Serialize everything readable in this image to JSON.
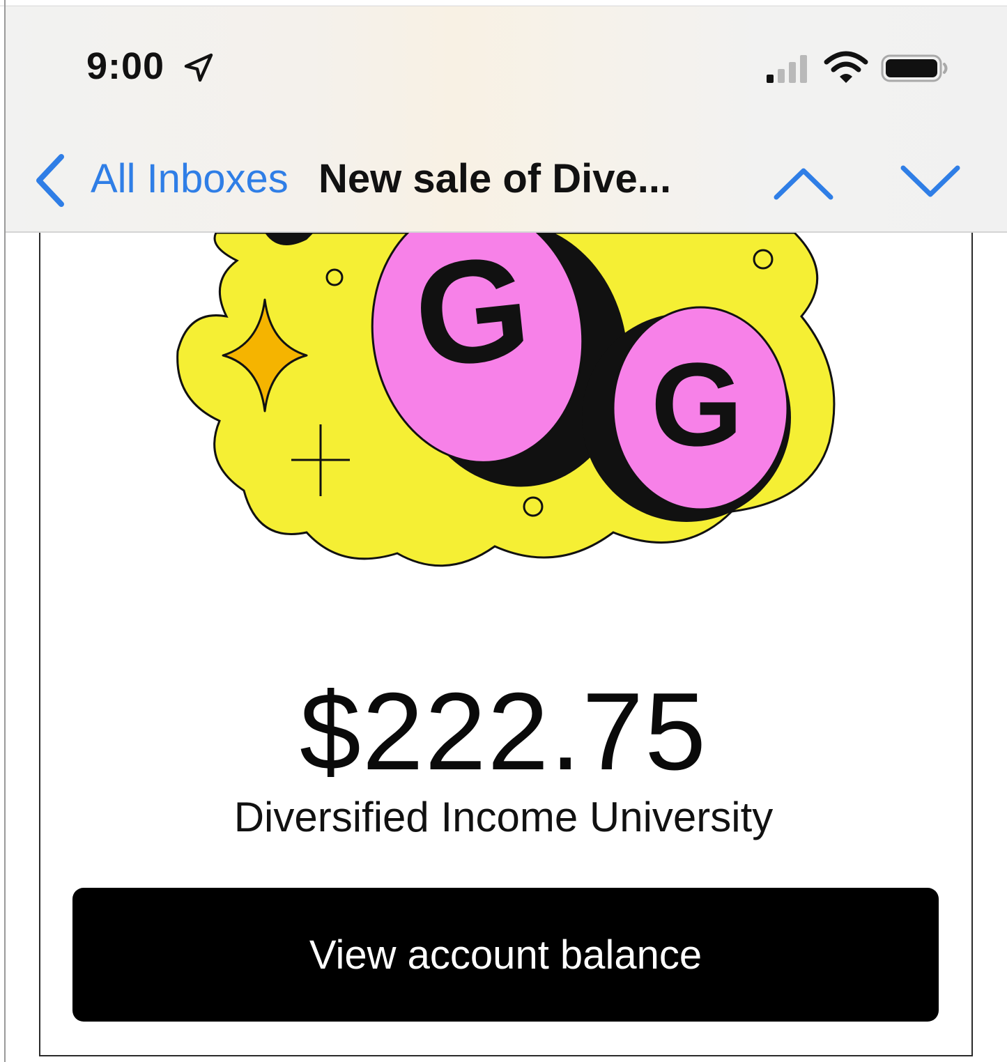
{
  "status_bar": {
    "time": "9:00",
    "icons": [
      "location-arrow-icon",
      "cellular-signal-icon",
      "wifi-icon",
      "battery-icon"
    ]
  },
  "nav_bar": {
    "back_label": "All Inboxes",
    "title": "New sale of Dive...",
    "icons": [
      "chevron-left-icon",
      "chevron-up-icon",
      "chevron-down-icon"
    ]
  },
  "email": {
    "amount": "$222.75",
    "product_name": "Diversified Income University",
    "cta_label": "View account balance"
  },
  "colors": {
    "link_blue": "#2f7ee6",
    "sticker_yellow": "#f5ef34",
    "sticker_pink": "#f781e8",
    "sparkle_orange": "#f5b400",
    "button_black": "#000000"
  }
}
